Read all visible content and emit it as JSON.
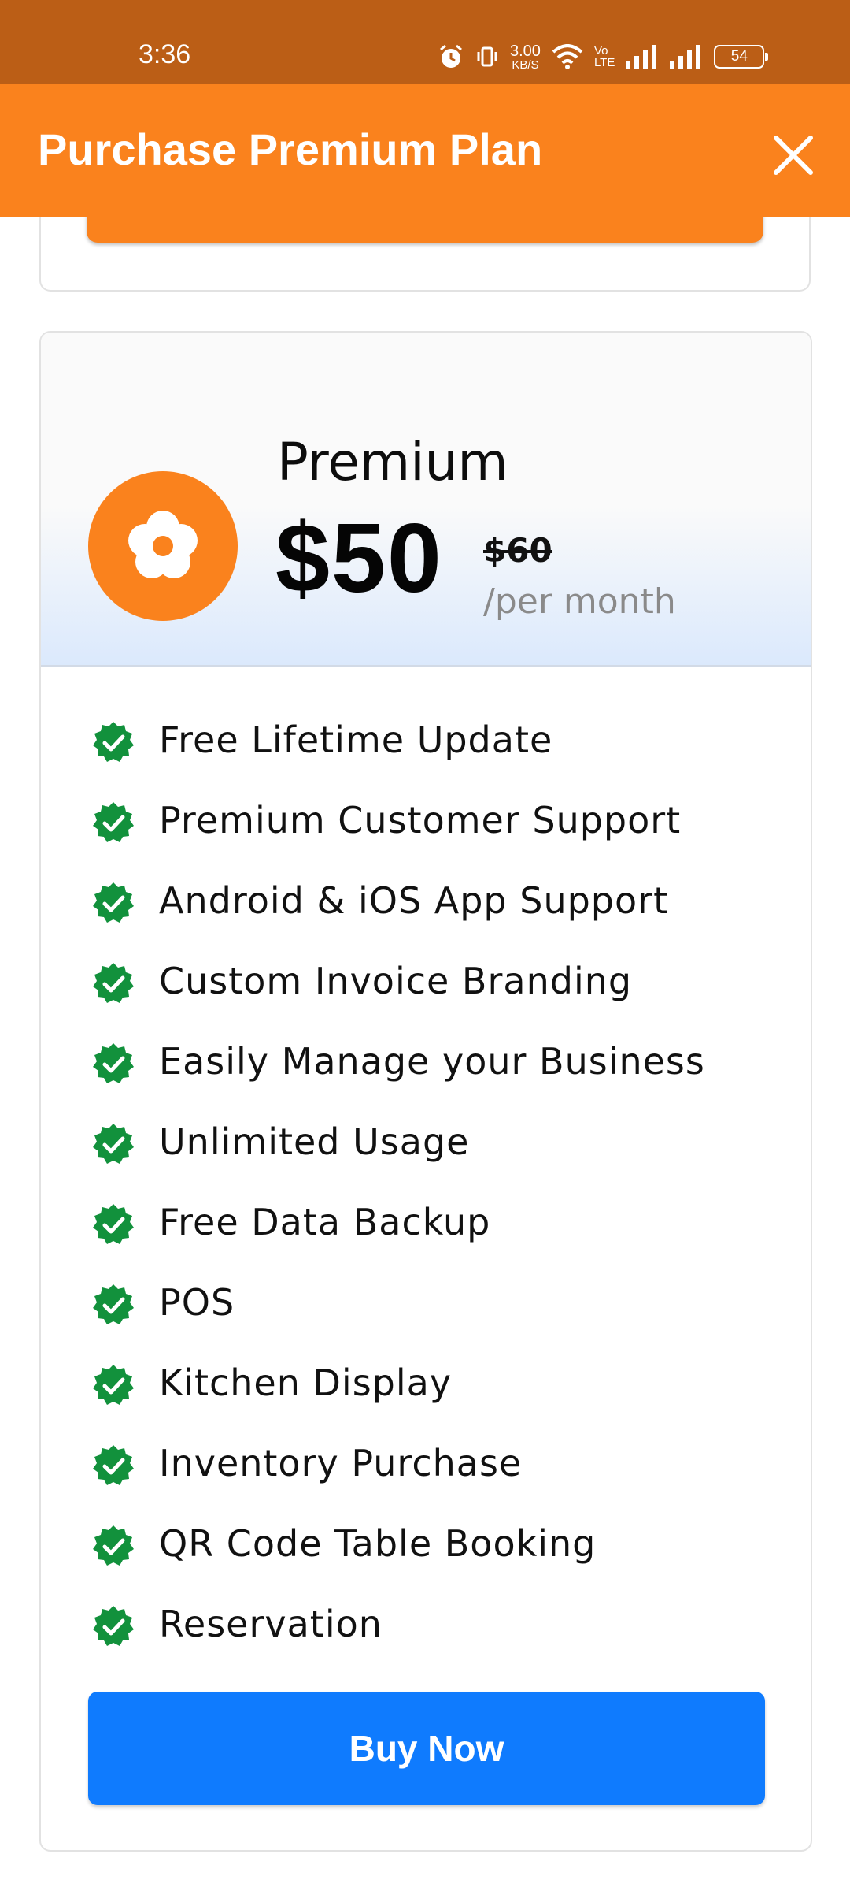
{
  "status_bar": {
    "time": "3:36",
    "net_speed_value": "3.00",
    "net_speed_unit": "KB/S",
    "volte_top": "Vo",
    "volte_bottom": "LTE",
    "battery": "54"
  },
  "header": {
    "title": "Purchase Premium Plan",
    "background": "#fa821d"
  },
  "plan": {
    "name": "Premium",
    "price": "$50",
    "old_price": "$60",
    "period": "/per month",
    "icon": "flower-icon",
    "features": [
      "Free Lifetime Update",
      "Premium Customer Support",
      "Android & iOS App Support",
      "Custom Invoice Branding",
      "Easily Manage your Business",
      "Unlimited Usage",
      "Free Data Backup",
      "POS",
      "Kitchen Display",
      "Inventory Purchase",
      "QR Code Table Booking",
      "Reservation"
    ],
    "buy_label": "Buy Now"
  },
  "colors": {
    "accent": "#fa821d",
    "status_bar": "#bb5e16",
    "buy": "#0f7bfe",
    "check": "#12913c"
  }
}
